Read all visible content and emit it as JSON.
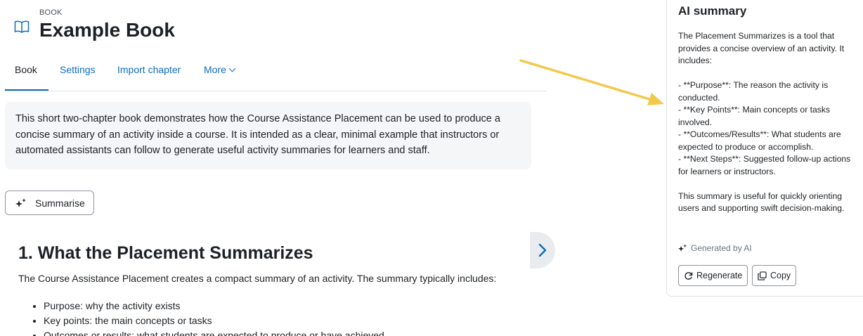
{
  "header": {
    "kicker": "BOOK",
    "title": "Example Book",
    "icon": "book-icon"
  },
  "tabs": [
    {
      "label": "Book",
      "active": true
    },
    {
      "label": "Settings",
      "active": false
    },
    {
      "label": "Import chapter",
      "active": false
    },
    {
      "label": "More",
      "active": false
    }
  ],
  "intro": {
    "text": "This short two-chapter book demonstrates how the Course Assistance Placement can be used to produce a concise summary of an activity inside a course. It is intended as a clear, minimal example that instructors or automated assistants can follow to generate useful activity summaries for learners and staff."
  },
  "summarise_button": {
    "label": "Summarise",
    "icon": "sparkle-icon"
  },
  "chapter": {
    "title": "1. What the Placement Summarizes",
    "body": "The Course Assistance Placement creates a compact summary of an activity. The summary typically includes:",
    "items": [
      "Purpose: why the activity exists",
      "Key points: the main concepts or tasks",
      "Outcomes or results: what students are expected to produce or have achieved"
    ]
  },
  "drawer_toggle": {
    "icon": "chevron-right-icon"
  },
  "ai_panel": {
    "title": "AI summary",
    "intro": "The Placement Summarizes is a tool that provides a concise overview of an activity. It includes:",
    "bullets": [
      "- **Purpose**: The reason the activity is conducted.",
      "- **Key Points**: Main concepts or tasks involved.",
      "- **Outcomes/Results**: What students are expected to produce or accomplish.",
      "- **Next Steps**: Suggested follow-up actions for learners or instructors."
    ],
    "closing": "This summary is useful for quickly orienting users and supporting swift decision-making.",
    "generated_label": "Generated by AI",
    "regenerate_label": "Regenerate",
    "copy_label": "Copy"
  },
  "colors": {
    "link": "#0f6cbf",
    "text": "#1d2125",
    "arrow": "#f2c94c",
    "intro_bg": "#f5f6f8"
  }
}
